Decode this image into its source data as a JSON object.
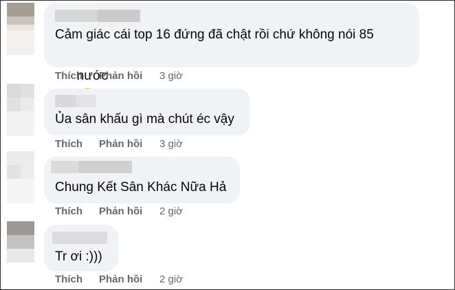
{
  "comments": [
    {
      "text": "Cảm giác cái top 16 đứng đã chật rồi chứ không nói 85",
      "text_line2": "nước",
      "emoji": "hot-face-emoji",
      "like": "Thích",
      "reply": "Phản hồi",
      "time": "3 giờ"
    },
    {
      "text": "Ủa sân khấu gì mà chút éc vậy",
      "like": "Thích",
      "reply": "Phản hồi",
      "time": "3 giờ"
    },
    {
      "text": "Chung Kết Sân Khác Nữa Hả",
      "like": "Thích",
      "reply": "Phản hồi",
      "time": "2 giờ"
    },
    {
      "text": "Tr ơi :)))",
      "like": "Thích",
      "reply": "Phản hồi",
      "time": "2 giờ"
    }
  ],
  "colors": {
    "bubble": "#f0f2f5",
    "text": "#050505",
    "meta": "#65676b"
  }
}
